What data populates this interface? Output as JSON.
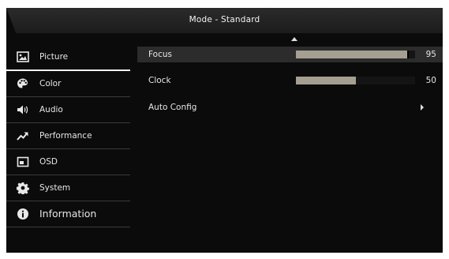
{
  "header": {
    "title": "Mode - Standard"
  },
  "sidebar": {
    "items": [
      {
        "label": "Picture",
        "icon": "picture-icon"
      },
      {
        "label": "Color",
        "icon": "palette-icon"
      },
      {
        "label": "Audio",
        "icon": "speaker-icon"
      },
      {
        "label": "Performance",
        "icon": "trend-up-icon"
      },
      {
        "label": "OSD",
        "icon": "osd-window-icon"
      },
      {
        "label": "System",
        "icon": "gear-icon"
      },
      {
        "label": "Information",
        "icon": "info-icon"
      }
    ],
    "selected": "Picture"
  },
  "main": {
    "rows": [
      {
        "label": "Focus",
        "value": "95",
        "level": 95
      },
      {
        "label": "Clock",
        "value": "50",
        "level": 50
      },
      {
        "label": "Auto Config"
      }
    ]
  },
  "colors": {
    "background": "#0b0b0b",
    "bar_fill": "#a49f91",
    "selected_row": "#2c2c2c"
  }
}
